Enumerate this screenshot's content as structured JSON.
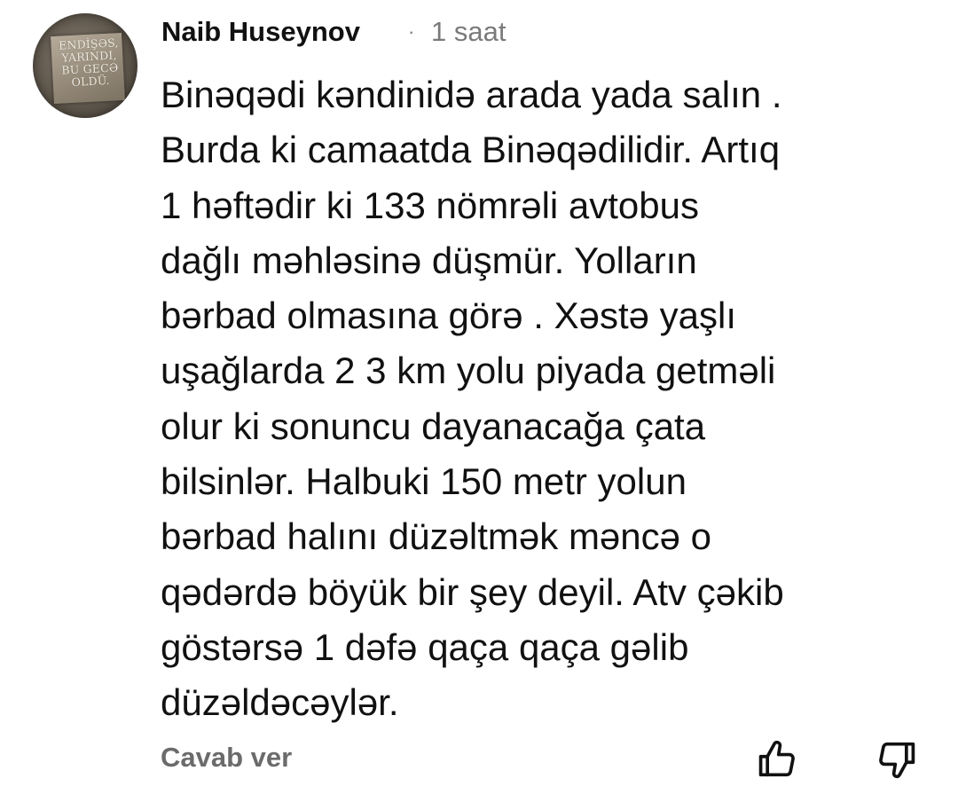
{
  "comment": {
    "author": "Naib Huseynov",
    "separator": "·",
    "time": "1 saat",
    "avatar_text": [
      "ENDİŞƏS,",
      "YARINDI,",
      "BU GECƏ",
      "OLDÜ."
    ],
    "body_lines": [
      "Binəqədi kəndinidə arada yada salın .",
      "Burda ki camaatda Binəqədilidir. Artıq",
      "1 həftədir ki 133 nömrəli avtobus",
      "dağlı məhləsinə düşmür. Yolların",
      "bərbad olmasına görə . Xəstə yaşlı",
      "uşağlarda 2 3 km yolu piyada getməli",
      "olur ki sonuncu dayanacağa çata",
      "bilsinlər. Halbuki 150 metr yolun",
      "bərbad halını düzəltmək məncə o",
      "qədərdə böyük bir şey deyil. Atv çəkib",
      "göstərsə 1 dəfə qaça qaça gəlib",
      "düzəldəcəylər."
    ],
    "reply_label": "Cavab ver",
    "like_icon": "thumbs-up-icon",
    "dislike_icon": "thumbs-down-icon"
  },
  "colors": {
    "text": "#111111",
    "muted": "#7a7a7a",
    "reply": "#6b6b6b",
    "background": "#ffffff"
  }
}
